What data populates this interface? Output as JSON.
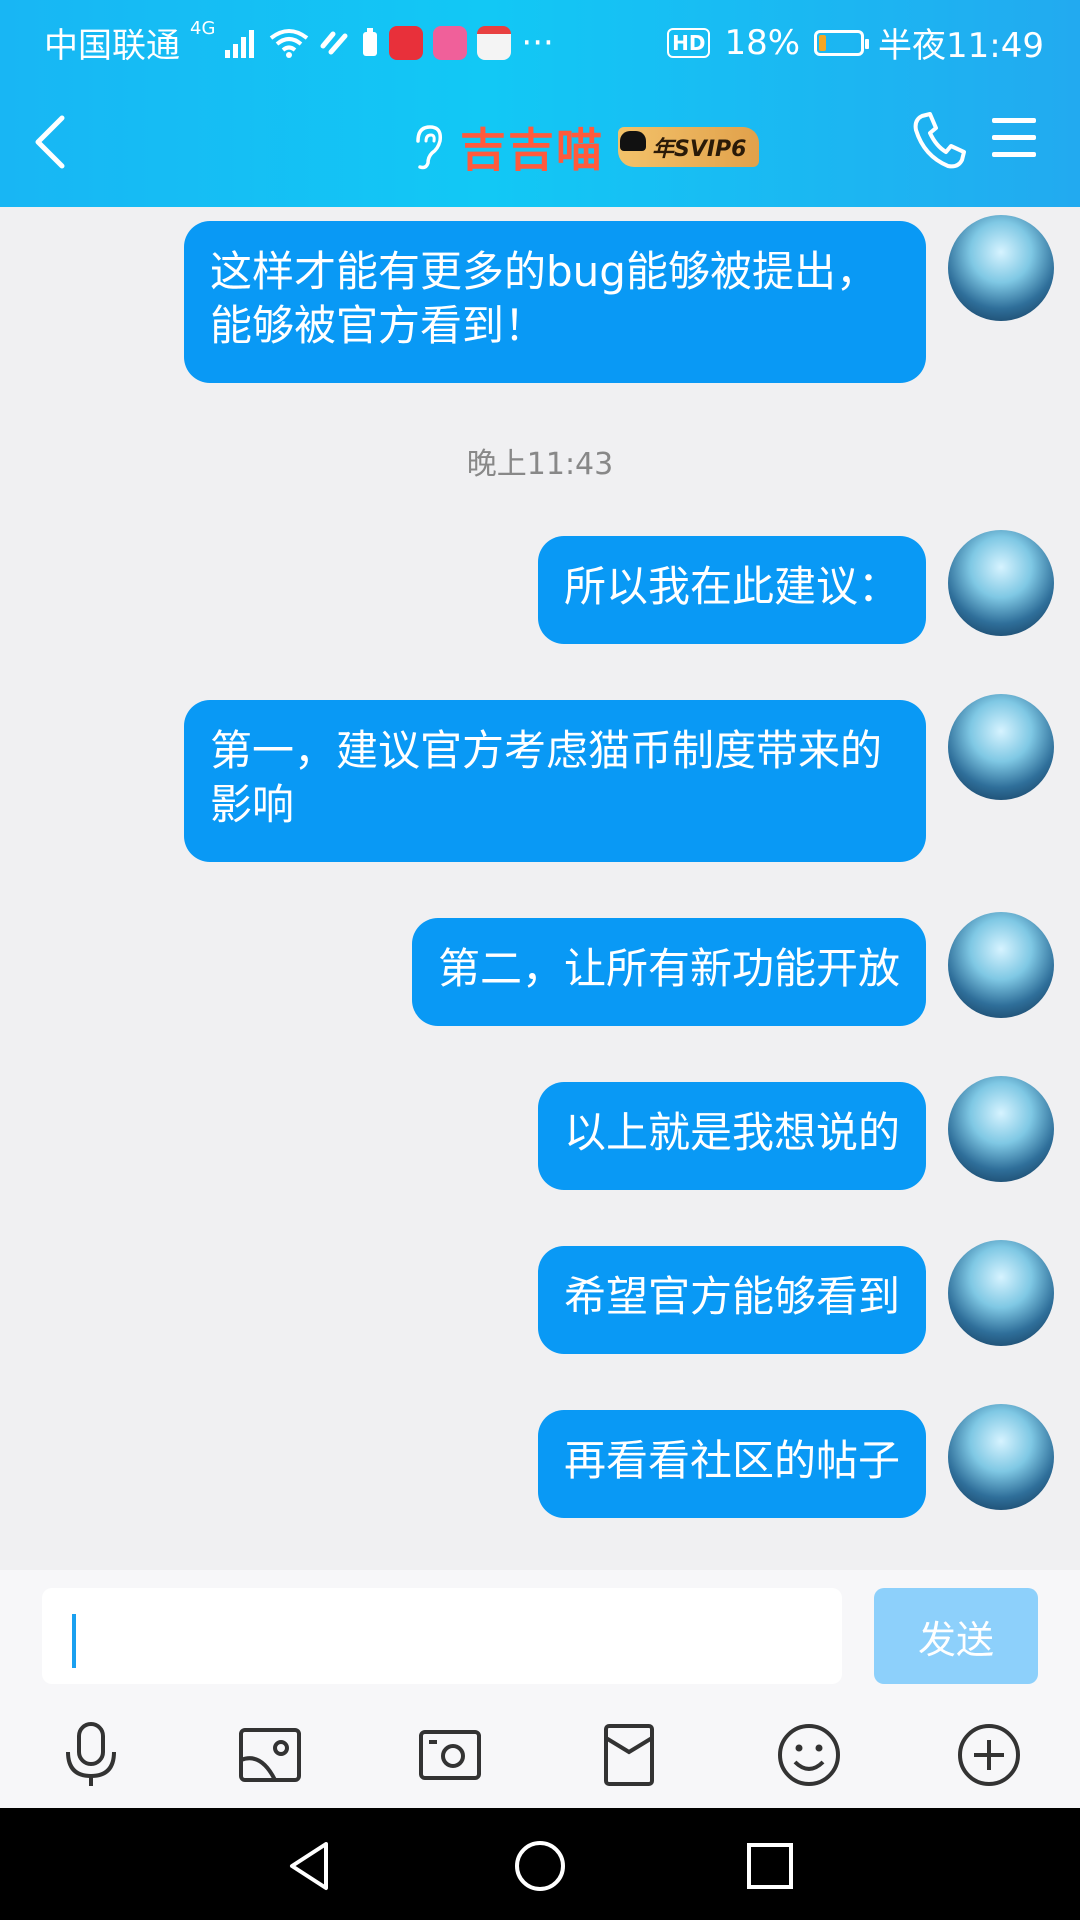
{
  "status_bar": {
    "carrier": "中国联通",
    "network": "4G",
    "more": "···",
    "hd": "HD",
    "battery_percent": "18%",
    "battery_level": 0.18,
    "time": "半夜11:49"
  },
  "header": {
    "title": "吉吉喵",
    "vip_badge": "年SVIP6"
  },
  "chat": {
    "messages": [
      {
        "text": "这样才能有更多的bug能够被提出，能够被官方看到！"
      },
      {
        "timestamp": "晚上11:43"
      },
      {
        "text": "所以我在此建议："
      },
      {
        "text": "第一，建议官方考虑猫币制度带来的影响"
      },
      {
        "text": "第二，让所有新功能开放"
      },
      {
        "text": "以上就是我想说的"
      },
      {
        "text": "希望官方能够看到"
      },
      {
        "text": "再看看社区的帖子"
      }
    ]
  },
  "input": {
    "value": "",
    "send_label": "发送"
  },
  "toolbar": {
    "icons": [
      "microphone-icon",
      "image-icon",
      "camera-icon",
      "red-packet-icon",
      "emoji-icon",
      "plus-icon"
    ]
  },
  "colors": {
    "header_start": "#18b6f4",
    "bubble": "#0999f5",
    "title": "#ff5a3c",
    "send_disabled": "#8dd0fb"
  }
}
